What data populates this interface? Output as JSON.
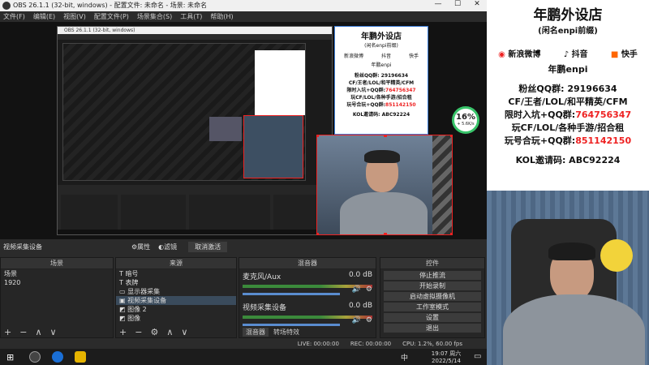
{
  "window": {
    "title": "OBS 26.1.1 (32-bit, windows) - 配置文件: 未命名 - 场景: 未命名",
    "controls": [
      "—",
      "☐",
      "✕"
    ]
  },
  "menu": [
    "文件(F)",
    "编辑(E)",
    "视图(V)",
    "配置文件(P)",
    "场景集合(S)",
    "工具(T)",
    "帮助(H)"
  ],
  "overlay_card": {
    "title": "年鹏外设店",
    "subtitle": "(闲名enpi前缀)",
    "social": [
      "新浪微博",
      "抖音",
      "快手"
    ],
    "handle": "年鹏enpi",
    "qq_line": "粉丝QQ群: 29196634",
    "games_line": "CF/王者/LOL/和平精英/CFM",
    "group_line_label": "限时入坑+QQ群:",
    "group_line_value": "764756347",
    "games_line2": "玩CF/LOL/各种手游/招合租",
    "group2_label": "玩号合玩+QQ群:",
    "group2_value": "851142150",
    "kol_line": "KOL邀请码: ABC92224"
  },
  "cpu_badge": {
    "percent": "16%",
    "rate": "+ 5.6K/s"
  },
  "source_bar": {
    "source_name": "视频采集设备",
    "props": "属性",
    "filters": "滤镜",
    "deactivate": "取消激活"
  },
  "docks": {
    "scenes": {
      "title": "场景",
      "items": [
        "场景",
        "1920"
      ]
    },
    "sources": {
      "title": "来源",
      "items": [
        "暗号",
        "表牌",
        "显示器采集",
        "视频采集设备",
        "图像 2",
        "图像"
      ]
    },
    "mixer": {
      "title": "混音器",
      "tracks": [
        {
          "name": "麦克风/Aux",
          "db": "0.0 dB"
        },
        {
          "name": "视频采集设备",
          "db": "0.0 dB"
        }
      ],
      "tabs": [
        "混音器",
        "转场特效"
      ]
    },
    "controls": {
      "title": "控件",
      "buttons": [
        "停止推流",
        "开始录制",
        "启动虚拟摄像机",
        "工作室模式",
        "设置",
        "退出"
      ]
    }
  },
  "status": {
    "live": "LIVE: 00:00:00",
    "rec": "REC: 00:00:00",
    "cpu": "CPU: 1.2%, 60.00 fps"
  },
  "taskbar": {
    "time": "19:07 周六",
    "date": "2022/5/14",
    "ime": "中"
  },
  "colors": {
    "accent_red": "#e22222",
    "badge_green": "#39c46a",
    "selection_blue": "#3a7bd5"
  }
}
